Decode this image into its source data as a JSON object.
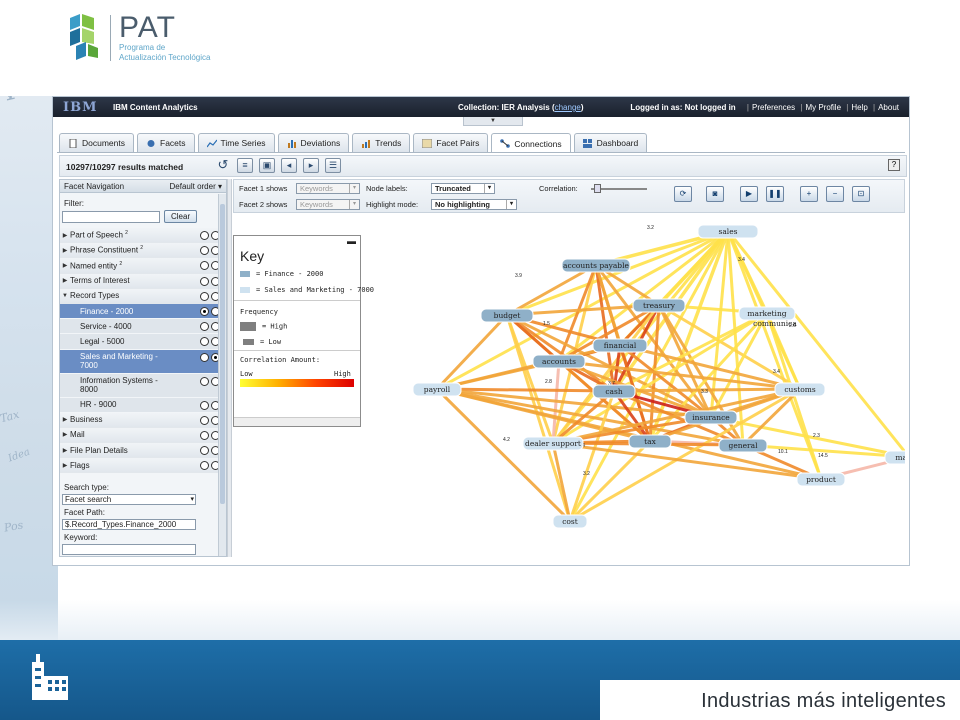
{
  "brand": {
    "name": "PAT",
    "subtitle_line1": "Programa de",
    "subtitle_line2": "Actualización Tecnológica",
    "tagline": "Industrias más inteligentes"
  },
  "app": {
    "vendor": "IBM",
    "product": "IBM Content Analytics",
    "collection_prefix": "Collection: IER Analysis (",
    "collection_link": "change",
    "collection_suffix": ")",
    "login_status": "Logged in as: Not logged in",
    "user_links": [
      "Preferences",
      "My Profile",
      "Help",
      "About"
    ]
  },
  "tabs": [
    {
      "label": "Documents",
      "active": false
    },
    {
      "label": "Facets",
      "active": false
    },
    {
      "label": "Time Series",
      "active": false
    },
    {
      "label": "Deviations",
      "active": false
    },
    {
      "label": "Trends",
      "active": false
    },
    {
      "label": "Facet Pairs",
      "active": false
    },
    {
      "label": "Connections",
      "active": true
    },
    {
      "label": "Dashboard",
      "active": false
    }
  ],
  "results": "10297/10297 results matched",
  "facet_nav": {
    "title": "Facet Navigation",
    "order": "Default order",
    "filter_label": "Filter:",
    "clear_label": "Clear",
    "items": [
      {
        "label": "Part of Speech",
        "sup": "2",
        "expanded": false
      },
      {
        "label": "Phrase Constituent",
        "sup": "2",
        "expanded": false
      },
      {
        "label": "Named entity",
        "sup": "2",
        "expanded": false
      },
      {
        "label": "Terms of Interest",
        "sup": "",
        "expanded": false
      },
      {
        "label": "Record Types",
        "sup": "",
        "expanded": true
      }
    ],
    "record_types": [
      {
        "label": "Finance - 2000",
        "selected": true
      },
      {
        "label": "Service - 4000",
        "selected": false
      },
      {
        "label": "Legal - 5000",
        "selected": false
      },
      {
        "label": "Sales and Marketing -",
        "label2": "7000",
        "selected": true
      },
      {
        "label": "Information Systems -",
        "label2": "8000",
        "selected": false
      },
      {
        "label": "HR - 9000",
        "selected": false
      }
    ],
    "items_after": [
      {
        "label": "Business"
      },
      {
        "label": "Mail"
      },
      {
        "label": "File Plan Details"
      },
      {
        "label": "Flags"
      }
    ],
    "search_type_label": "Search type:",
    "search_type_value": "Facet search",
    "facet_path_label": "Facet Path:",
    "facet_path_value": "$.Record_Types.Finance_2000",
    "keyword_label": "Keyword:"
  },
  "controls": {
    "facet1_label": "Facet 1 shows",
    "facet1_value": "Keywords",
    "facet2_label": "Facet 2 shows",
    "facet2_value": "Keywords",
    "node_labels_label": "Node labels:",
    "node_labels_value": "Truncated",
    "highlight_label": "Highlight mode:",
    "highlight_value": "No highlighting",
    "correlation_label": "Correlation:"
  },
  "key": {
    "title": "Key",
    "finance": "= Finance - 2000",
    "sales": "= Sales and Marketing - 7000",
    "frequency": "Frequency",
    "high": "= High",
    "low": "= Low",
    "correlation_amount": "Correlation Amount:",
    "low_label": "Low",
    "high_label": "High",
    "finance_color": "#8fb0c8",
    "sales_color": "#cfe2f0"
  },
  "graph": {
    "nodes": [
      "sales",
      "accounts payable",
      "budget",
      "treasury",
      "marketing",
      "communica",
      "financial",
      "accounts",
      "payroll",
      "cash",
      "customs",
      "insurance",
      "dealer support",
      "tax",
      "general",
      "market",
      "product",
      "cost"
    ],
    "edge_labels": [
      "3.2",
      "3.9",
      "3.4",
      "1.5",
      "2.6",
      "3.4",
      "2.3",
      "14.5",
      "4.7",
      "2.4",
      "4.2",
      "3.2",
      "3.7",
      "3.3",
      "10.1",
      "2.8"
    ]
  }
}
